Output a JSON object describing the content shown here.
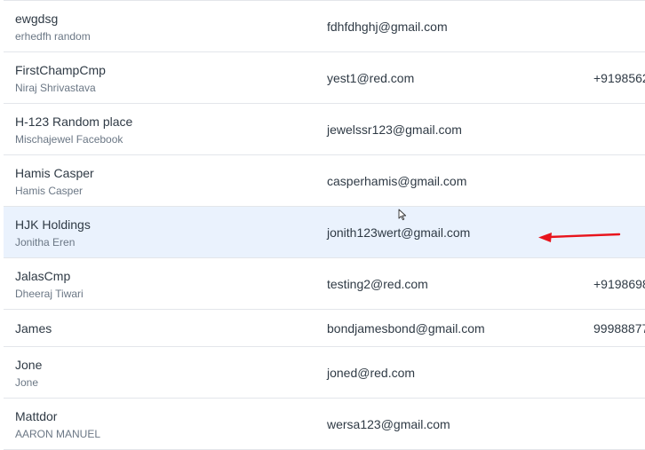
{
  "rows": [
    {
      "name": "ewgdsg",
      "sub": "erhedfh random",
      "email": "fdhfdhghj@gmail.com",
      "phone": ""
    },
    {
      "name": "FirstChampCmp",
      "sub": "Niraj Shrivastava",
      "email": "yest1@red.com",
      "phone": "+9198562"
    },
    {
      "name": "H-123 Random place",
      "sub": "Mischajewel Facebook",
      "email": "jewelssr123@gmail.com",
      "phone": ""
    },
    {
      "name": "Hamis Casper",
      "sub": "Hamis Casper",
      "email": "casperhamis@gmail.com",
      "phone": ""
    },
    {
      "name": "HJK Holdings",
      "sub": "Jonitha Eren",
      "email": "jonith123wert@gmail.com",
      "phone": ""
    },
    {
      "name": "JalasCmp",
      "sub": "Dheeraj Tiwari",
      "email": "testing2@red.com",
      "phone": "+9198698"
    },
    {
      "name": "James",
      "sub": "",
      "email": "bondjamesbond@gmail.com",
      "phone": "99988877"
    },
    {
      "name": "Jone",
      "sub": "Jone",
      "email": "joned@red.com",
      "phone": ""
    },
    {
      "name": "Mattdor",
      "sub": "AARON MANUEL",
      "email": "wersa123@gmail.com",
      "phone": ""
    }
  ],
  "highlight_color": "#eaf2fd",
  "annotation_color": "#e8141c"
}
